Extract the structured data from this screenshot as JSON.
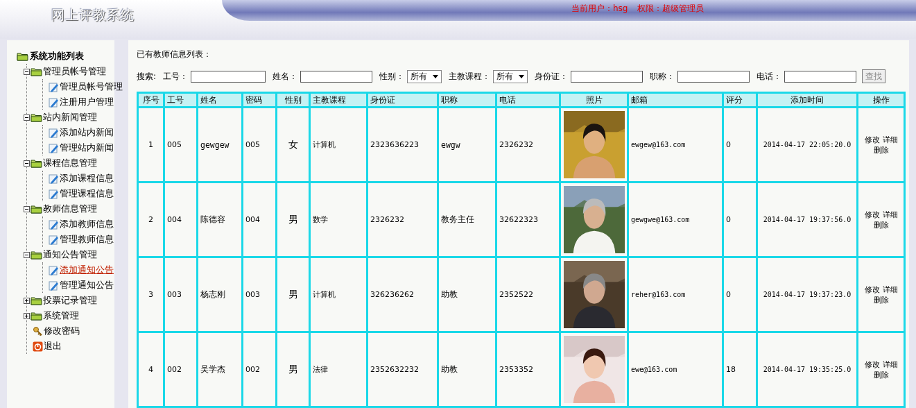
{
  "header": {
    "title": "网上评教系统",
    "current_user": "当前用户：hsg",
    "role": "权限：超级管理员"
  },
  "sidebar": {
    "title": "系统功能列表",
    "items": [
      {
        "label": "管理员帐号管理",
        "kind": "group",
        "expanded": true,
        "children": [
          {
            "label": "管理员帐号管理",
            "kind": "page",
            "active": false
          },
          {
            "label": "注册用户管理",
            "kind": "page",
            "active": false
          }
        ]
      },
      {
        "label": "站内新闻管理",
        "kind": "group",
        "expanded": true,
        "children": [
          {
            "label": "添加站内新闻",
            "kind": "page",
            "active": false
          },
          {
            "label": "管理站内新闻",
            "kind": "page",
            "active": false
          }
        ]
      },
      {
        "label": "课程信息管理",
        "kind": "group",
        "expanded": true,
        "children": [
          {
            "label": "添加课程信息",
            "kind": "page",
            "active": false
          },
          {
            "label": "管理课程信息",
            "kind": "page",
            "active": false
          }
        ]
      },
      {
        "label": "教师信息管理",
        "kind": "group",
        "expanded": true,
        "children": [
          {
            "label": "添加教师信息",
            "kind": "page",
            "active": false
          },
          {
            "label": "管理教师信息",
            "kind": "page",
            "active": false
          }
        ]
      },
      {
        "label": "通知公告管理",
        "kind": "group",
        "expanded": true,
        "children": [
          {
            "label": "添加通知公告",
            "kind": "page",
            "active": true
          },
          {
            "label": "管理通知公告",
            "kind": "page",
            "active": false
          }
        ]
      },
      {
        "label": "投票记录管理",
        "kind": "group",
        "expanded": false
      },
      {
        "label": "系统管理",
        "kind": "group",
        "expanded": false
      },
      {
        "label": "修改密码",
        "kind": "key",
        "active": false
      },
      {
        "label": "退出",
        "kind": "exit",
        "active": false
      }
    ]
  },
  "main": {
    "heading": "已有教师信息列表：",
    "search": {
      "label": "搜索:",
      "fields": [
        {
          "label": "工号：",
          "kind": "text"
        },
        {
          "label": "姓名：",
          "kind": "text"
        },
        {
          "label": "性别：",
          "kind": "select",
          "value": "所有"
        },
        {
          "label": "主教课程：",
          "kind": "select",
          "value": "所有"
        },
        {
          "label": "身份证：",
          "kind": "text"
        },
        {
          "label": "职称：",
          "kind": "text"
        },
        {
          "label": "电话：",
          "kind": "text"
        }
      ],
      "button": "查找"
    },
    "table": {
      "columns": [
        "序号",
        "工号",
        "姓名",
        "密码",
        "性别",
        "主教课程",
        "身份证",
        "职称",
        "电话",
        "照片",
        "邮箱",
        "评分",
        "添加时间",
        "操作"
      ],
      "rows": [
        {
          "cells": [
            "1",
            "005",
            "gewgew",
            "005",
            "女",
            "计算机",
            "2323636223",
            "ewgw",
            "2326232"
          ],
          "photo": {
            "kind": "picture"
          },
          "email": "ewgew@163.com",
          "score": "0",
          "added": "2014-04-17 22:05:20.0",
          "actions": [
            "修改",
            "详细",
            "删除"
          ]
        },
        {
          "cells": [
            "2",
            "004",
            "陈德容",
            "004",
            "男",
            "数学",
            "2326232",
            "教务主任",
            "32622323"
          ],
          "photo": {
            "kind": "picture"
          },
          "email": "gewgwe@163.com",
          "score": "0",
          "added": "2014-04-17 19:37:56.0",
          "actions": [
            "修改",
            "详细",
            "删除"
          ]
        },
        {
          "cells": [
            "3",
            "003",
            "杨志刚",
            "003",
            "男",
            "计算机",
            "326236262",
            "助教",
            "2352522"
          ],
          "photo": {
            "kind": "picture"
          },
          "email": "reher@163.com",
          "score": "0",
          "added": "2014-04-17 19:37:23.0",
          "actions": [
            "修改",
            "详细",
            "删除"
          ]
        },
        {
          "cells": [
            "4",
            "002",
            "吴学杰",
            "002",
            "男",
            "法律",
            "2352632232",
            "助教",
            "2353352"
          ],
          "photo": {
            "kind": "picture"
          },
          "email": "ewe@163.com",
          "score": "18",
          "added": "2014-04-17 19:35:25.0",
          "actions": [
            "修改",
            "详细",
            "删除"
          ]
        }
      ]
    }
  }
}
